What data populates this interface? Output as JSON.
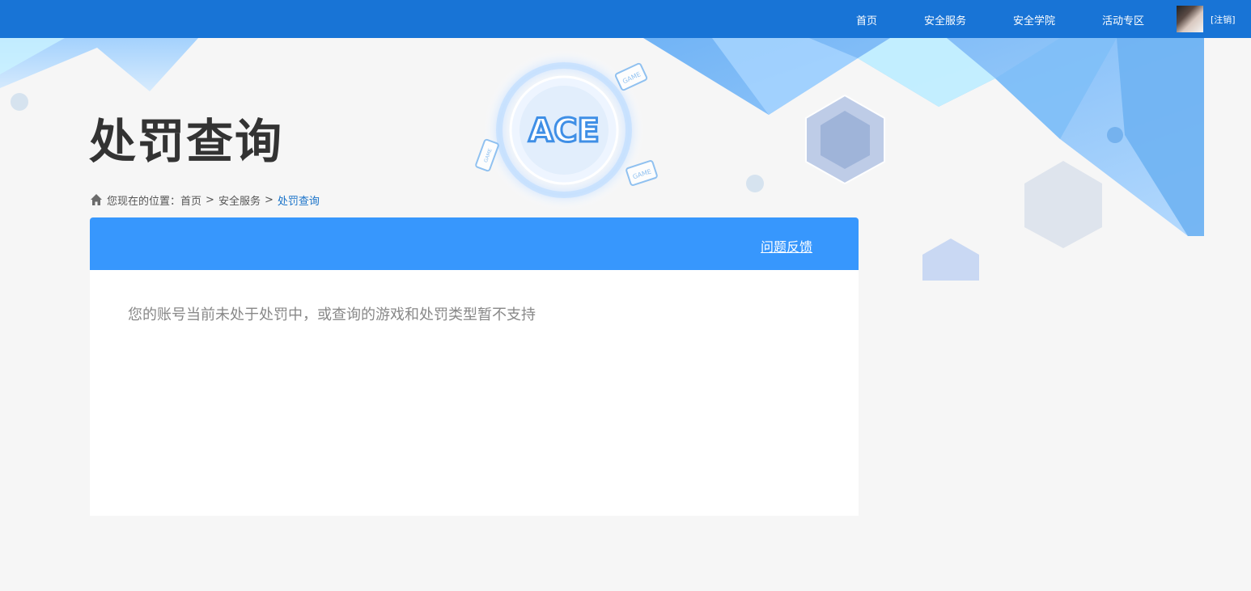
{
  "nav": {
    "items": [
      "首页",
      "安全服务",
      "安全学院",
      "活动专区"
    ],
    "logout": "[注销]"
  },
  "banner": {
    "logo_text": "ACE",
    "badge_text": "GAME"
  },
  "page": {
    "title": "处罚查询"
  },
  "breadcrumb": {
    "prefix": "您现在的位置：",
    "items": [
      "首页",
      "安全服务",
      "处罚查询"
    ],
    "separator": ">"
  },
  "panel": {
    "feedback_link": "问题反馈",
    "notice": "您的账号当前未处于处罚中，或查询的游戏和处罚类型暂不支持"
  },
  "colors": {
    "topbar": "#1874d6",
    "panel_header": "#3797fd",
    "breadcrumb_current": "#1a73c9",
    "title": "#333333"
  }
}
